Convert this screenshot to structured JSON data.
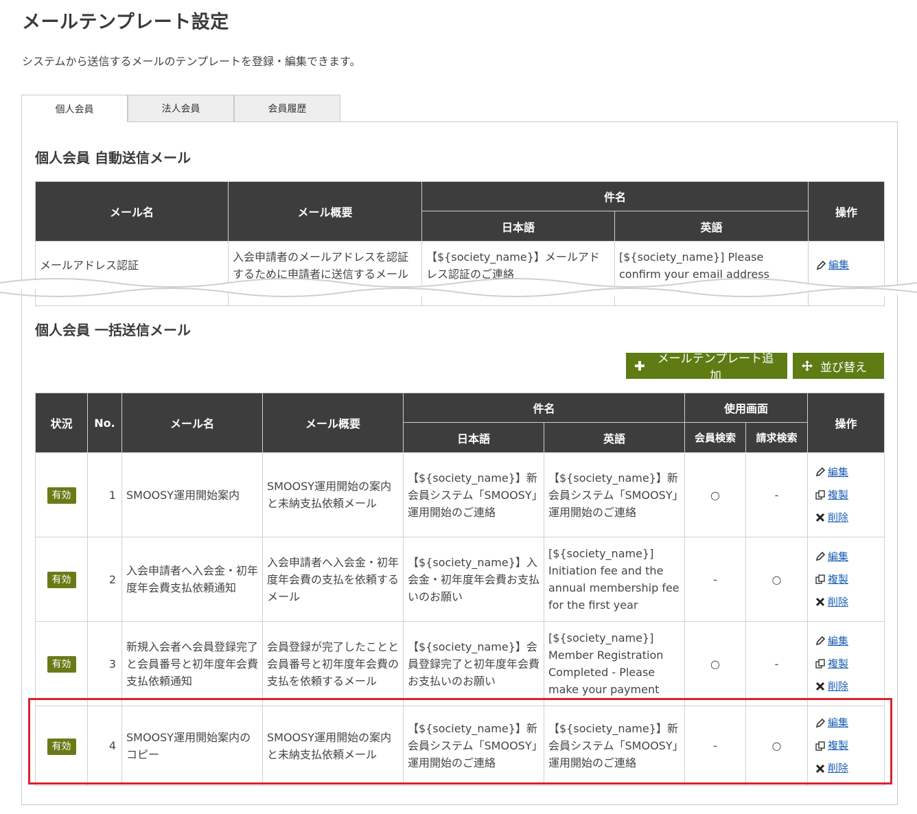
{
  "page": {
    "title": "メールテンプレート設定",
    "description": "システムから送信するメールのテンプレートを登録・編集できます。"
  },
  "tabs": [
    {
      "label": "個人会員",
      "active": true
    },
    {
      "label": "法人会員",
      "active": false
    },
    {
      "label": "会員履歴",
      "active": false
    }
  ],
  "auto_section": {
    "title": "個人会員 自動送信メール",
    "headers": {
      "name": "メール名",
      "summary": "メール概要",
      "subject": "件名",
      "ja": "日本語",
      "en": "英語",
      "ops": "操作"
    },
    "row": {
      "name": "メールアドレス認証",
      "summary": "入会申請者のメールアドレスを認証するために申請者に送信するメール",
      "ja": "【${society_name}】メールアドレス認証のご連絡",
      "en": "[${society_name}] Please confirm your email address",
      "edit": "編集"
    }
  },
  "bulk_section": {
    "title": "個人会員 一括送信メール",
    "add_button": "メールテンプレート追加",
    "sort_button": "並び替え",
    "headers": {
      "status": "状況",
      "no": "No.",
      "name": "メール名",
      "summary": "メール概要",
      "subject": "件名",
      "ja": "日本語",
      "en": "英語",
      "screens": "使用画面",
      "member_search": "会員検索",
      "billing_search": "請求検索",
      "ops": "操作"
    },
    "op_labels": {
      "edit": "編集",
      "copy": "複製",
      "delete": "削除"
    },
    "rows": [
      {
        "status": "有効",
        "no": "1",
        "name": "SMOOSY運用開始案内",
        "summary": "SMOOSY運用開始の案内と未納支払依頼メール",
        "ja": "【${society_name}】新会員システム「SMOOSY」運用開始のご連絡",
        "en": "【${society_name}】新会員システム「SMOOSY」運用開始のご連絡",
        "member_search": "○",
        "billing_search": "-"
      },
      {
        "status": "有効",
        "no": "2",
        "name": "入会申請者へ入会金・初年度年会費支払依頼通知",
        "summary": "入会申請者へ入会金・初年度年会費の支払を依頼するメール",
        "ja": "【${society_name}】入会金・初年度年会費お支払いのお願い",
        "en": "[${society_name}] Initiation fee and the annual membership fee for the first year",
        "member_search": "-",
        "billing_search": "○"
      },
      {
        "status": "有効",
        "no": "3",
        "name": "新規入会者へ会員登録完了と会員番号と初年度年会費支払依頼通知",
        "summary": "会員登録が完了したことと会員番号と初年度年会費の支払を依頼するメール",
        "ja": "【${society_name}】会員登録完了と初年度年会費お支払いのお願い",
        "en": "[${society_name}] Member Registration Completed - Please make your payment",
        "member_search": "○",
        "billing_search": "-"
      },
      {
        "status": "有効",
        "no": "4",
        "name": "SMOOSY運用開始案内のコピー",
        "summary": "SMOOSY運用開始の案内と未納支払依頼メール",
        "ja": "【${society_name}】新会員システム「SMOOSY」運用開始のご連絡",
        "en": "【${society_name}】新会員システム「SMOOSY」運用開始のご連絡",
        "member_search": "-",
        "billing_search": "○"
      }
    ]
  },
  "colors": {
    "header_bg": "#3d3d3d",
    "button_green": "#5e7c13",
    "badge_green": "#6b7a17",
    "link_blue": "#1a5fb4",
    "highlight_red": "#d9232d"
  }
}
